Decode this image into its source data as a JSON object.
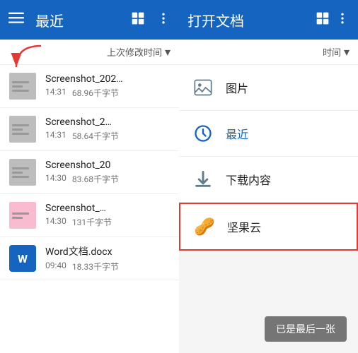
{
  "left_panel": {
    "header": {
      "title": "最近",
      "menu_icon": "menu-icon",
      "grid_icon": "grid-icon",
      "more_icon": "more-icon"
    },
    "sort_bar": {
      "label": "上次修改时间",
      "chevron": "▾"
    },
    "files": [
      {
        "name": "Screenshot_202…",
        "time": "14:31",
        "size": "68.96千字节",
        "type": "screenshot"
      },
      {
        "name": "Screenshot_2…",
        "time": "14:31",
        "size": "58.64千字节",
        "type": "screenshot"
      },
      {
        "name": "Screenshot_20",
        "time": "14:30",
        "size": "83.68千字节",
        "type": "screenshot"
      },
      {
        "name": "Screenshot_…",
        "time": "14:30",
        "size": "131千字节",
        "type": "pink-screenshot"
      },
      {
        "name": "Word文档.docx",
        "time": "09:40",
        "size": "18.33千字节",
        "type": "word"
      }
    ]
  },
  "right_panel": {
    "header": {
      "title": "打开文档",
      "grid_icon": "grid-icon",
      "more_icon": "more-icon"
    },
    "sort_bar": {
      "label": "时间",
      "chevron": "▾"
    },
    "sources": [
      {
        "name": "图片",
        "icon": "🖼",
        "type": "normal"
      },
      {
        "name": "最近",
        "icon": "⏱",
        "type": "recent"
      },
      {
        "name": "下载内容",
        "icon": "⬇",
        "type": "normal"
      },
      {
        "name": "坚果云",
        "icon": "🥜",
        "type": "highlighted"
      }
    ],
    "bottom_button": "已是最后一张"
  },
  "annotation": {
    "arrow_color": "#e53935"
  }
}
